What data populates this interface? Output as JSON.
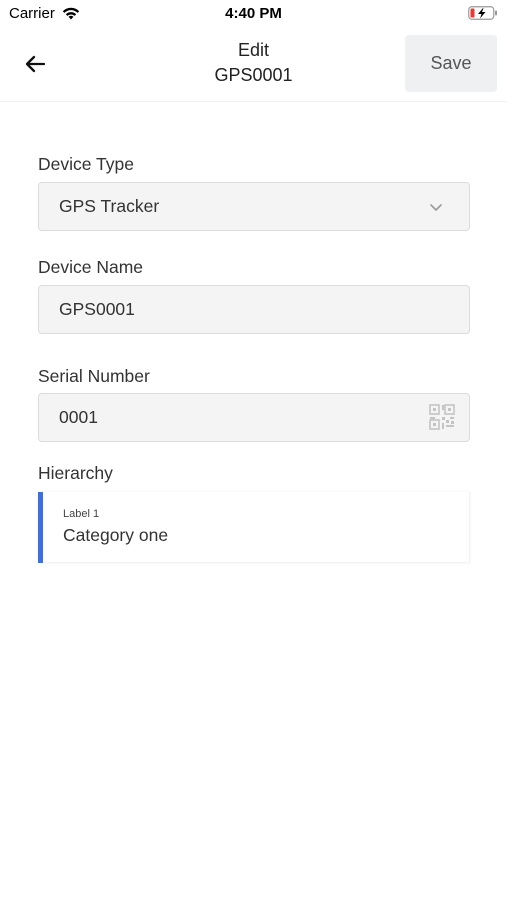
{
  "status_bar": {
    "carrier": "Carrier",
    "time": "4:40 PM",
    "wifi_icon": "wifi-icon",
    "battery_icon": "battery-charging-icon"
  },
  "header": {
    "back_icon": "arrow-left-icon",
    "title_line1": "Edit",
    "title_line2": "GPS0001",
    "save_label": "Save"
  },
  "form": {
    "device_type": {
      "label": "Device Type",
      "value": "GPS Tracker",
      "icon": "chevron-down-icon"
    },
    "device_name": {
      "label": "Device Name",
      "value": "GPS0001"
    },
    "serial_number": {
      "label": "Serial Number",
      "value": "0001",
      "icon": "qr-code-icon"
    },
    "hierarchy": {
      "label": "Hierarchy",
      "items": [
        {
          "label": "Label 1",
          "value": "Category one"
        }
      ]
    }
  },
  "colors": {
    "accent": "#3d6fe0",
    "field_bg": "#f4f4f4",
    "save_bg": "#eef0f2"
  }
}
